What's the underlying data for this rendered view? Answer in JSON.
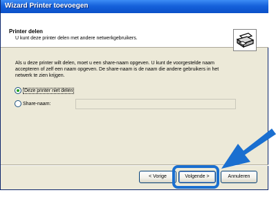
{
  "window": {
    "title": "Wizard Printer toevoegen"
  },
  "header": {
    "title": "Printer delen",
    "subtitle": "U kunt deze printer delen met andere netwerkgebruikers."
  },
  "body": {
    "text": "Als u deze printer wilt delen, moet u een share-naam opgeven. U kunt de voorgestelde naam accepteren of zelf een naam opgeven. De share-naam is de naam die andere gebruikers in het netwerk te zien krijgen."
  },
  "options": {
    "no_share_label": "Deze printer niet delen",
    "no_share_selected": true,
    "share_label": "Share-naam:",
    "share_selected": false,
    "share_name_value": ""
  },
  "buttons": {
    "prev_label": "< Vorige",
    "next_label": "Volgende >",
    "cancel_label": "Annuleren"
  },
  "colors": {
    "titlebar": "#0a4fc8",
    "highlight": "#1a6fd0",
    "dialog_bg": "#ece9d8"
  },
  "icons": {
    "header_icon": "printer-icon",
    "pointer": "pointing-arrow"
  }
}
